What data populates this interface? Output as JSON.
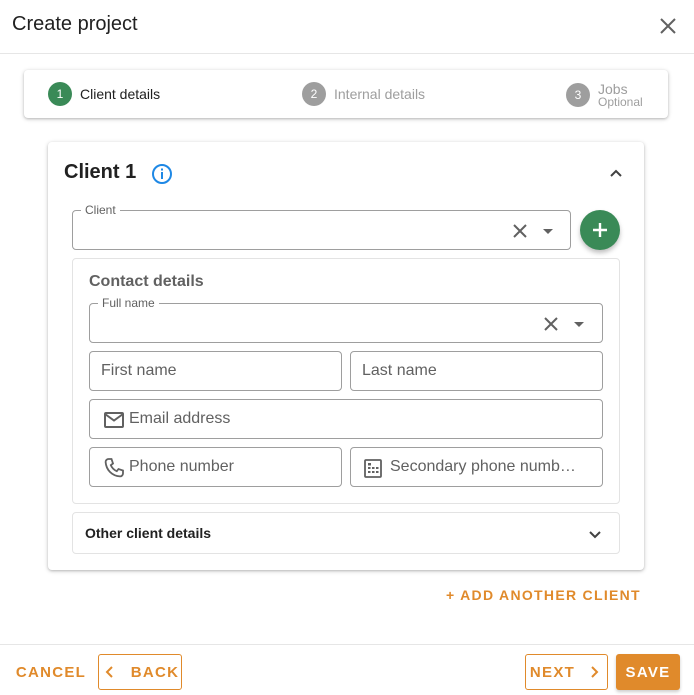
{
  "dialog": {
    "title": "Create project"
  },
  "stepper": {
    "steps": [
      {
        "number": "1",
        "label": "Client details",
        "active": true
      },
      {
        "number": "2",
        "label": "Internal details",
        "active": false
      },
      {
        "number": "3",
        "label": "Jobs",
        "sublabel": "Optional",
        "active": false
      }
    ]
  },
  "client_card": {
    "title": "Client 1",
    "client_field": {
      "label": "Client",
      "value": ""
    },
    "contact": {
      "title": "Contact details",
      "full_name": {
        "label": "Full name",
        "value": ""
      },
      "first_name_placeholder": "First name",
      "last_name_placeholder": "Last name",
      "email_placeholder": "Email address",
      "phone_placeholder": "Phone number",
      "secondary_phone_placeholder": "Secondary phone numb…"
    },
    "other_details_title": "Other client details"
  },
  "add_client_label": "+ ADD ANOTHER CLIENT",
  "footer": {
    "cancel": "CANCEL",
    "back": "BACK",
    "next": "NEXT",
    "save": "SAVE"
  },
  "colors": {
    "accent": "#e08a2b",
    "step_active": "#3a8a57",
    "step_inactive": "#9e9e9e",
    "info": "#1e88e5"
  }
}
